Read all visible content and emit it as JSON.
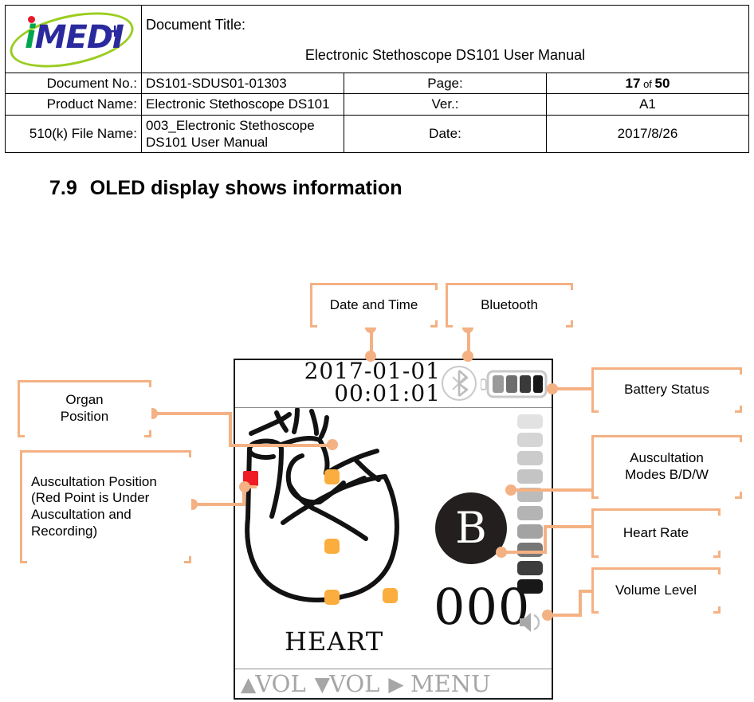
{
  "header": {
    "logo": {
      "text_i": "i",
      "text_medi": "MEDI",
      "text_plus": "+"
    },
    "doc_title_label": "Document Title:",
    "doc_title_value": "Electronic Stethoscope DS101 User Manual",
    "rows": [
      {
        "label": "Document No.:",
        "value": "DS101-SDUS01-01303",
        "right_label": "Page:",
        "right_value_pre": "17",
        "right_value_mid": " of ",
        "right_value_post": "50"
      },
      {
        "label": "Product Name:",
        "value": "Electronic Stethoscope DS101",
        "right_label": "Ver.:",
        "right_value": "A1"
      },
      {
        "label": "510(k) File Name:",
        "value": "003_Electronic Stethoscope DS101 User Manual",
        "right_label": "Date:",
        "right_value": "2017/8/26"
      }
    ]
  },
  "section": {
    "number": "7.9",
    "title": "OLED display shows information"
  },
  "oled": {
    "date": "2017-01-01",
    "time": "00:01:01",
    "bluetooth_icon": "bluetooth-icon",
    "battery_icon": "battery-icon",
    "battery_segments": 4,
    "organ_label": "HEART",
    "mode_letter": "B",
    "heart_rate": "000",
    "speaker_icon": "speaker-icon",
    "volume_bars": 10,
    "volume_bar_colors": [
      "#e2e2e2",
      "#d5d5d5",
      "#cbcbcb",
      "#c4c4c4",
      "#bcbcbc",
      "#b4b4b4",
      "#a3a3a3",
      "#767676",
      "#3d3d3d",
      "#181818"
    ],
    "battery_segment_colors": [
      "#9a9a9a",
      "#6e6e6e",
      "#3a3a3a",
      "#181818"
    ],
    "menubar": {
      "vol_up_icon": "triangle-up-icon",
      "vol_up_label": "VOL",
      "vol_down_icon": "triangle-down-icon",
      "vol_down_label": "VOL",
      "menu_icon": "triangle-right-icon",
      "menu_label": "MENU"
    },
    "auscultation_point_active_color": "#EE1C25",
    "auscultation_point_color": "#FBAD3D"
  },
  "callouts": {
    "date_time": "Date and Time",
    "bluetooth": "Bluetooth",
    "battery_status": "Battery Status",
    "organ_position": "Organ\nPosition",
    "organ_position_l1": "Organ",
    "organ_position_l2": "Position",
    "auscultation_position": "Auscultation Position (Red Point is Under Auscultation and Recording)",
    "auscultation_modes_l1": "Auscultation",
    "auscultation_modes_l2": "Modes B/D/W",
    "heart_rate": "Heart Rate",
    "volume_level": "Volume Level"
  },
  "colors": {
    "callout_border": "#F4B183",
    "logo_green": "#00A550",
    "logo_blue": "#2A2A9E",
    "logo_ellipse": "#9ACD1E",
    "logo_dot_red": "#E8192C"
  }
}
